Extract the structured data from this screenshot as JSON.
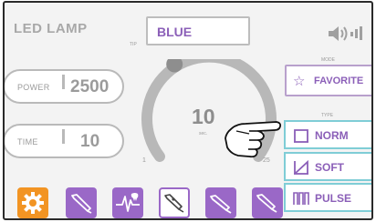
{
  "header": {
    "title": "LED LAMP",
    "tip_label": "TIP",
    "tip_value": "BLUE",
    "speaker_icon": "speaker-volume-icon"
  },
  "power": {
    "label": "POWER",
    "value": "2500"
  },
  "time": {
    "label": "TIME",
    "value": "10"
  },
  "dial": {
    "value": "10",
    "unit": "sec.",
    "min": "1",
    "max": "25",
    "level": 0.375
  },
  "mode": {
    "label": "MODE",
    "favorite_label": "FAVORITE"
  },
  "type": {
    "label": "TYPE",
    "options": [
      {
        "label": "NORM",
        "icon": "square-wave-icon"
      },
      {
        "label": "SOFT",
        "icon": "ramp-icon"
      },
      {
        "label": "PULSE",
        "icon": "pulse-icon"
      }
    ]
  },
  "toolbar": {
    "icons": [
      "gear-icon",
      "handpiece-icon",
      "tooth-scan-icon",
      "handpiece-angled-icon",
      "handpiece-icon",
      "handpiece-icon"
    ]
  },
  "colors": {
    "accent": "#9a68c7",
    "selected_border": "#7fcdd6",
    "settings_tile": "#f29423",
    "text_gray": "#9b9b9b"
  }
}
